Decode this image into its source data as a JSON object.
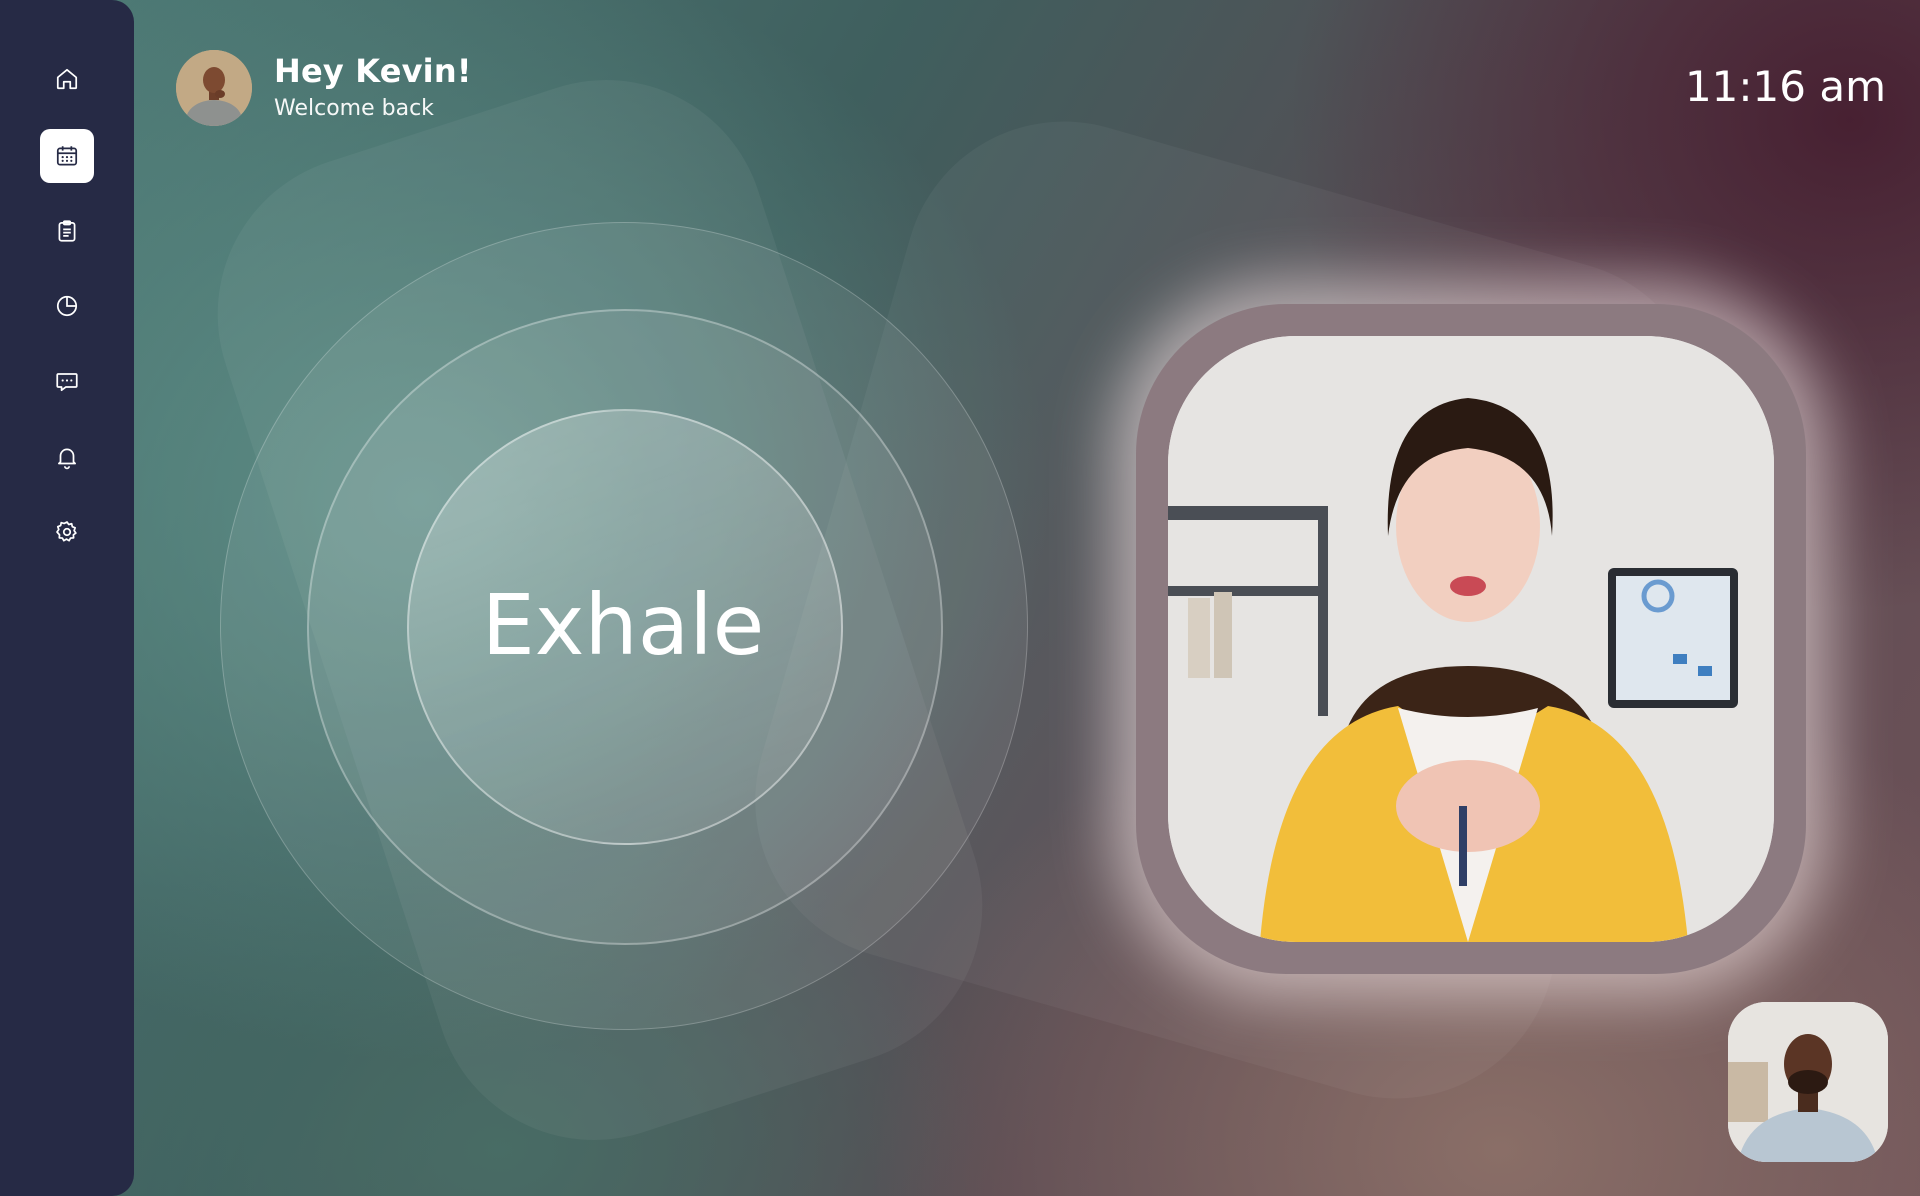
{
  "user": {
    "greeting": "Hey Kevin!",
    "subtitle": "Welcome back"
  },
  "clock": {
    "time": "11:16 am"
  },
  "breathing": {
    "instruction": "Exhale"
  },
  "sidebar": {
    "items": [
      {
        "icon": "home-icon",
        "active": false
      },
      {
        "icon": "calendar-icon",
        "active": true
      },
      {
        "icon": "clipboard-icon",
        "active": false
      },
      {
        "icon": "pie-chart-icon",
        "active": false
      },
      {
        "icon": "chat-icon",
        "active": false
      },
      {
        "icon": "bell-icon",
        "active": false
      },
      {
        "icon": "gear-icon",
        "active": false
      }
    ]
  },
  "colors": {
    "sidebar": "#262a45",
    "frame": "#8c7a80",
    "accent": "#ffffff"
  }
}
